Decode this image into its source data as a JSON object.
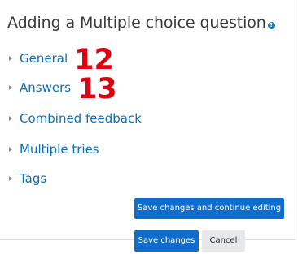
{
  "page": {
    "title": "Adding a Multiple choice question",
    "help_icon_glyph": "?"
  },
  "sections": [
    {
      "label": "General",
      "annotation": "12"
    },
    {
      "label": "Answers",
      "annotation": "13"
    },
    {
      "label": "Combined feedback"
    },
    {
      "label": "Multiple tries"
    },
    {
      "label": "Tags"
    }
  ],
  "buttons": {
    "save_continue": "Save changes and continue editing",
    "save": "Save changes",
    "cancel": "Cancel"
  },
  "colors": {
    "link": "#0e6eb8",
    "primary_button": "#0f6ecd",
    "secondary_button": "#e6e8ea",
    "annotation": "#e0000f"
  },
  "icons": {
    "help": "question-circle-icon",
    "section_toggle": "caret-right-icon"
  }
}
